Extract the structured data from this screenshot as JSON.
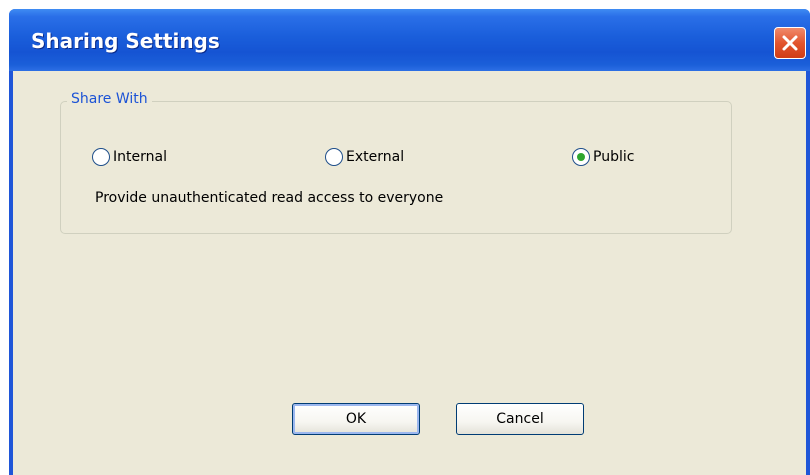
{
  "window": {
    "title": "Sharing Settings",
    "close_icon": "close-icon",
    "close_color": "#e2552f"
  },
  "share_group": {
    "legend": "Share With",
    "options": [
      {
        "label": "Internal",
        "selected": false
      },
      {
        "label": "External",
        "selected": false
      },
      {
        "label": "Public",
        "selected": true
      }
    ],
    "description": "Provide unauthenticated read access to everyone"
  },
  "buttons": {
    "ok_label": "OK",
    "cancel_label": "Cancel"
  },
  "colors": {
    "titlebar": "#1554d3",
    "legend_text": "#1c53d6",
    "radio_selected": "#2ea62e",
    "dialog_bg": "#ece9d8"
  }
}
